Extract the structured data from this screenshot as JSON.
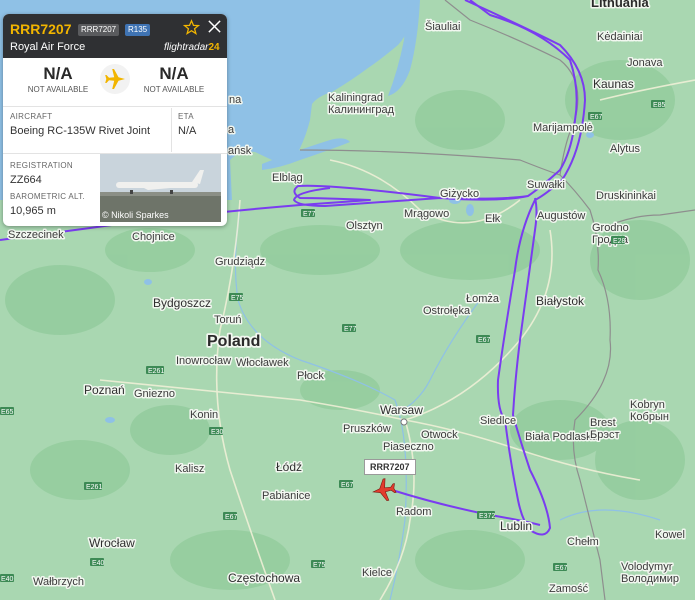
{
  "flight": {
    "callsign": "RRR7207",
    "registration_badge": "RRR7207",
    "type_badge": "R135",
    "airline": "Royal Air Force",
    "brand": "flightradar",
    "brand_suffix": "24",
    "origin_code": "N/A",
    "origin_sub": "NOT AVAILABLE",
    "dest_code": "N/A",
    "dest_sub": "NOT AVAILABLE",
    "aircraft_label": "AIRCRAFT",
    "aircraft_value": "Boeing RC-135W Rivet Joint",
    "eta_label": "ETA",
    "eta_value": "N/A",
    "registration_label": "REGISTRATION",
    "registration_value": "ZZ664",
    "altitude_label": "BAROMETRIC ALT.",
    "altitude_value": "10,965 m",
    "photo_credit": "© Nikoli Sparkes"
  },
  "map_label": "RRR7207",
  "places": {
    "lithuania": "Lithuania",
    "siauliai": "Šiauliai",
    "kedainiai": "Kėdainiai",
    "jonava": "Jonava",
    "kaunas": "Kaunas",
    "kaliningrad": "Kaliningrad",
    "kaliningrad_ru": "Калининград",
    "marijampole": "Marijampolė",
    "alytus": "Alytus",
    "druskininkai": "Druskininkai",
    "suwalki": "Suwałki",
    "augustow": "Augustów",
    "grodno": "Grodno",
    "grodno_ru": "Гродна",
    "gizycko": "Giżycko",
    "elk": "Ełk",
    "elblag": "Elbląg",
    "mragowo": "Mrągowo",
    "olsztyn": "Olsztyn",
    "szczecinek": "Szczecinek",
    "chojnice": "Chojnice",
    "grudziadz": "Grudziądz",
    "lomza": "Łomża",
    "ostroleka": "Ostrołęka",
    "bialystok": "Białystok",
    "bydgoszcz": "Bydgoszcz",
    "torun": "Toruń",
    "poland": "Poland",
    "inowroclaw": "Inowrocław",
    "wloclawek": "Włocławek",
    "plock": "Płock",
    "poznan": "Poznań",
    "gniezno": "Gniezno",
    "konin": "Konin",
    "warsaw": "Warsaw",
    "pruszkow": "Pruszków",
    "otwock": "Otwock",
    "piaseczno": "Piaseczno",
    "siedlce": "Siedlce",
    "biala_podlaska": "Biała Podlaska",
    "brest": "Brest",
    "brest_ru": "Брэст",
    "kobryn": "Kobryn",
    "kobryn_ru": "Кобрын",
    "kalisz": "Kalisz",
    "lodz": "Łódź",
    "pabianice": "Pabianice",
    "radom": "Radom",
    "lublin": "Lublin",
    "chelm": "Chełm",
    "kowel": "Kowel",
    "wroclaw": "Wrocław",
    "walbrzych": "Wałbrzych",
    "czestochowa": "Częstochowa",
    "kielce": "Kielce",
    "zamosc": "Zamość",
    "volodymyr": "Volodymyr",
    "volodymyr_ua": "Володимир",
    "ansk": "ańsk",
    "na": "na",
    "edge_a": "a"
  },
  "roads": [
    "E77",
    "E67",
    "E75",
    "E261",
    "E30",
    "E67",
    "E67",
    "E372",
    "E85",
    "E28",
    "E65",
    "E261",
    "E40",
    "E67",
    "E77",
    "E75",
    "E67",
    "E40"
  ],
  "colors": {
    "land": "#a9d7b1",
    "water": "#8fc1e6",
    "track": "#7a3cf0",
    "aircraft": "#e23b2e",
    "callsign": "#f2b500"
  }
}
